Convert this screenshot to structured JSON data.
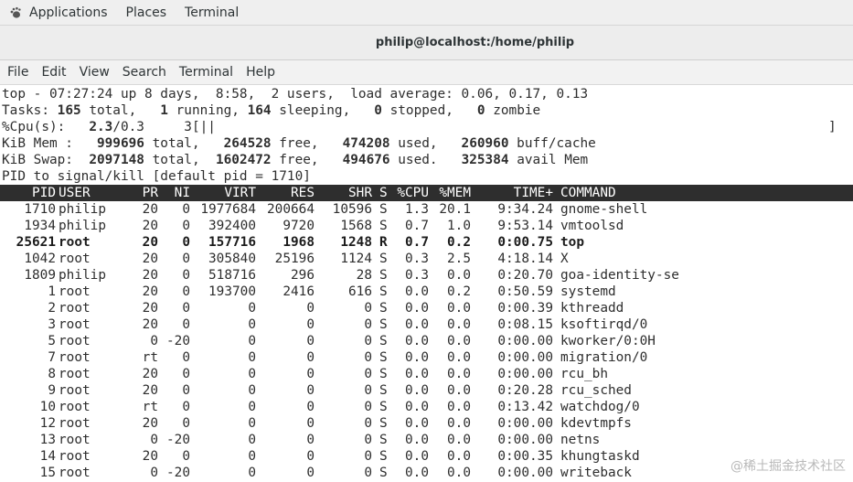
{
  "panel": {
    "applications": "Applications",
    "places": "Places",
    "terminal": "Terminal"
  },
  "window": {
    "title": "philip@localhost:/home/philip"
  },
  "menu": [
    "File",
    "Edit",
    "View",
    "Search",
    "Terminal",
    "Help"
  ],
  "summary": {
    "top_prefix": "top - 07:27:24 up 8 days,  8:58,  2 users,  load average: 0.06, 0.17, 0.13",
    "tasks": {
      "label": "Tasks: ",
      "total_value": "165",
      "total_label": " total,   ",
      "running_value": "1",
      "running_label": " running, ",
      "sleeping_value": "164",
      "sleeping_label": " sleeping,   ",
      "stopped_value": "0",
      "stopped_label": " stopped,   ",
      "zombie_value": "0",
      "zombie_label": " zombie"
    },
    "cpu": {
      "label": "%Cpu(s):   ",
      "value_bold": "2.3",
      "value_rest": "/0.3     3[||",
      "end": "]"
    },
    "mem": {
      "label": "KiB Mem :   ",
      "total": "999696",
      "total_label": " total,   ",
      "free": "264528",
      "free_label": " free,   ",
      "used": "474208",
      "used_label": " used,   ",
      "cache": "260960",
      "cache_label": " buff/cache"
    },
    "swap": {
      "label": "KiB Swap:  ",
      "total": "2097148",
      "total_label": " total,  ",
      "free": "1602472",
      "free_label": " free,   ",
      "used": "494676",
      "used_label": " used.   ",
      "avail": "325384",
      "avail_label": " avail Mem"
    },
    "prompt": "PID to signal/kill [default pid = 1710]"
  },
  "table": {
    "headers": {
      "pid": "PID",
      "user": "USER",
      "pr": "PR",
      "ni": "NI",
      "virt": "VIRT",
      "res": "RES",
      "shr": "SHR",
      "s": "S",
      "cpu": "%CPU",
      "mem": "%MEM",
      "time": "TIME+",
      "command": "COMMAND"
    },
    "rows": [
      {
        "pid": "1710",
        "user": "philip",
        "pr": "20",
        "ni": "0",
        "virt": "1977684",
        "res": "200664",
        "shr": "10596",
        "s": "S",
        "cpu": "1.3",
        "mem": "20.1",
        "time": "9:34.24",
        "command": "gnome-shell"
      },
      {
        "pid": "1934",
        "user": "philip",
        "pr": "20",
        "ni": "0",
        "virt": "392400",
        "res": "9720",
        "shr": "1568",
        "s": "S",
        "cpu": "0.7",
        "mem": "1.0",
        "time": "9:53.14",
        "command": "vmtoolsd"
      },
      {
        "pid": "25621",
        "user": "root",
        "pr": "20",
        "ni": "0",
        "virt": "157716",
        "res": "1968",
        "shr": "1248",
        "s": "R",
        "cpu": "0.7",
        "mem": "0.2",
        "time": "0:00.75",
        "command": "top"
      },
      {
        "pid": "1042",
        "user": "root",
        "pr": "20",
        "ni": "0",
        "virt": "305840",
        "res": "25196",
        "shr": "1124",
        "s": "S",
        "cpu": "0.3",
        "mem": "2.5",
        "time": "4:18.14",
        "command": "X"
      },
      {
        "pid": "1809",
        "user": "philip",
        "pr": "20",
        "ni": "0",
        "virt": "518716",
        "res": "296",
        "shr": "28",
        "s": "S",
        "cpu": "0.3",
        "mem": "0.0",
        "time": "0:20.70",
        "command": "goa-identity-se"
      },
      {
        "pid": "1",
        "user": "root",
        "pr": "20",
        "ni": "0",
        "virt": "193700",
        "res": "2416",
        "shr": "616",
        "s": "S",
        "cpu": "0.0",
        "mem": "0.2",
        "time": "0:50.59",
        "command": "systemd"
      },
      {
        "pid": "2",
        "user": "root",
        "pr": "20",
        "ni": "0",
        "virt": "0",
        "res": "0",
        "shr": "0",
        "s": "S",
        "cpu": "0.0",
        "mem": "0.0",
        "time": "0:00.39",
        "command": "kthreadd"
      },
      {
        "pid": "3",
        "user": "root",
        "pr": "20",
        "ni": "0",
        "virt": "0",
        "res": "0",
        "shr": "0",
        "s": "S",
        "cpu": "0.0",
        "mem": "0.0",
        "time": "0:08.15",
        "command": "ksoftirqd/0"
      },
      {
        "pid": "5",
        "user": "root",
        "pr": "0",
        "ni": "-20",
        "virt": "0",
        "res": "0",
        "shr": "0",
        "s": "S",
        "cpu": "0.0",
        "mem": "0.0",
        "time": "0:00.00",
        "command": "kworker/0:0H"
      },
      {
        "pid": "7",
        "user": "root",
        "pr": "rt",
        "ni": "0",
        "virt": "0",
        "res": "0",
        "shr": "0",
        "s": "S",
        "cpu": "0.0",
        "mem": "0.0",
        "time": "0:00.00",
        "command": "migration/0"
      },
      {
        "pid": "8",
        "user": "root",
        "pr": "20",
        "ni": "0",
        "virt": "0",
        "res": "0",
        "shr": "0",
        "s": "S",
        "cpu": "0.0",
        "mem": "0.0",
        "time": "0:00.00",
        "command": "rcu_bh"
      },
      {
        "pid": "9",
        "user": "root",
        "pr": "20",
        "ni": "0",
        "virt": "0",
        "res": "0",
        "shr": "0",
        "s": "S",
        "cpu": "0.0",
        "mem": "0.0",
        "time": "0:20.28",
        "command": "rcu_sched"
      },
      {
        "pid": "10",
        "user": "root",
        "pr": "rt",
        "ni": "0",
        "virt": "0",
        "res": "0",
        "shr": "0",
        "s": "S",
        "cpu": "0.0",
        "mem": "0.0",
        "time": "0:13.42",
        "command": "watchdog/0"
      },
      {
        "pid": "12",
        "user": "root",
        "pr": "20",
        "ni": "0",
        "virt": "0",
        "res": "0",
        "shr": "0",
        "s": "S",
        "cpu": "0.0",
        "mem": "0.0",
        "time": "0:00.00",
        "command": "kdevtmpfs"
      },
      {
        "pid": "13",
        "user": "root",
        "pr": "0",
        "ni": "-20",
        "virt": "0",
        "res": "0",
        "shr": "0",
        "s": "S",
        "cpu": "0.0",
        "mem": "0.0",
        "time": "0:00.00",
        "command": "netns"
      },
      {
        "pid": "14",
        "user": "root",
        "pr": "20",
        "ni": "0",
        "virt": "0",
        "res": "0",
        "shr": "0",
        "s": "S",
        "cpu": "0.0",
        "mem": "0.0",
        "time": "0:00.35",
        "command": "khungtaskd"
      },
      {
        "pid": "15",
        "user": "root",
        "pr": "0",
        "ni": "-20",
        "virt": "0",
        "res": "0",
        "shr": "0",
        "s": "S",
        "cpu": "0.0",
        "mem": "0.0",
        "time": "0:00.00",
        "command": "writeback"
      }
    ]
  },
  "watermark": "@稀土掘金技术社区",
  "icons": {
    "applications": "gnome-foot-icon"
  }
}
